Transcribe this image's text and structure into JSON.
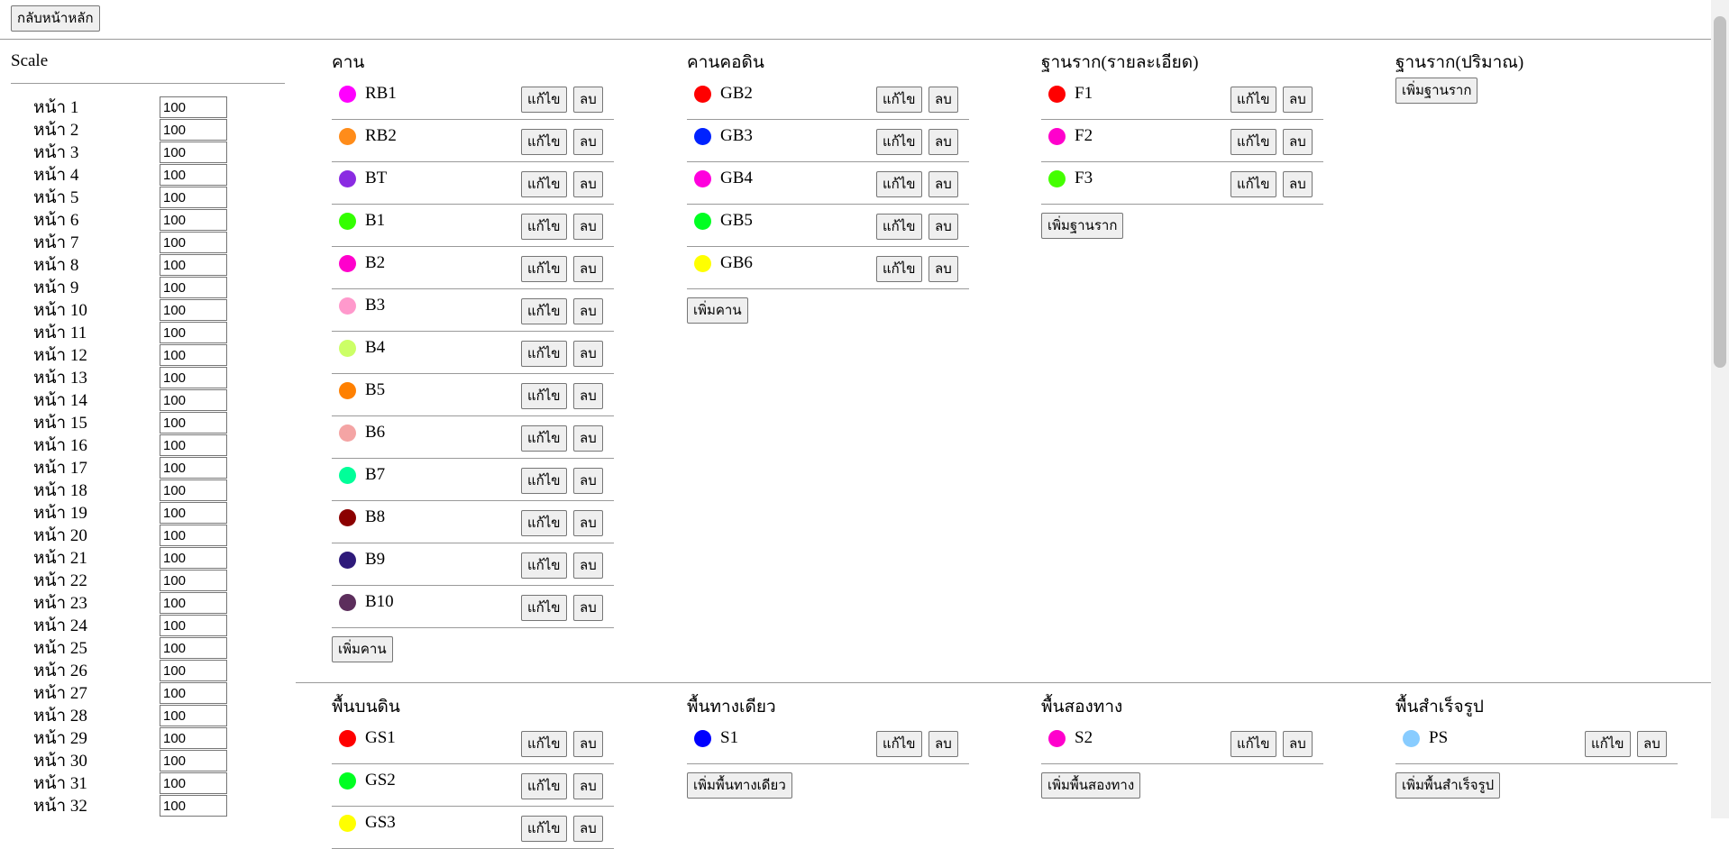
{
  "home_button": "กลับหน้าหลัก",
  "sidebar": {
    "title": "Scale",
    "pages": [
      {
        "label": "หน้า 1",
        "value": "100"
      },
      {
        "label": "หน้า 2",
        "value": "100"
      },
      {
        "label": "หน้า 3",
        "value": "100"
      },
      {
        "label": "หน้า 4",
        "value": "100"
      },
      {
        "label": "หน้า 5",
        "value": "100"
      },
      {
        "label": "หน้า 6",
        "value": "100"
      },
      {
        "label": "หน้า 7",
        "value": "100"
      },
      {
        "label": "หน้า 8",
        "value": "100"
      },
      {
        "label": "หน้า 9",
        "value": "100"
      },
      {
        "label": "หน้า 10",
        "value": "100"
      },
      {
        "label": "หน้า 11",
        "value": "100"
      },
      {
        "label": "หน้า 12",
        "value": "100"
      },
      {
        "label": "หน้า 13",
        "value": "100"
      },
      {
        "label": "หน้า 14",
        "value": "100"
      },
      {
        "label": "หน้า 15",
        "value": "100"
      },
      {
        "label": "หน้า 16",
        "value": "100"
      },
      {
        "label": "หน้า 17",
        "value": "100"
      },
      {
        "label": "หน้า 18",
        "value": "100"
      },
      {
        "label": "หน้า 19",
        "value": "100"
      },
      {
        "label": "หน้า 20",
        "value": "100"
      },
      {
        "label": "หน้า 21",
        "value": "100"
      },
      {
        "label": "หน้า 22",
        "value": "100"
      },
      {
        "label": "หน้า 23",
        "value": "100"
      },
      {
        "label": "หน้า 24",
        "value": "100"
      },
      {
        "label": "หน้า 25",
        "value": "100"
      },
      {
        "label": "หน้า 26",
        "value": "100"
      },
      {
        "label": "หน้า 27",
        "value": "100"
      },
      {
        "label": "หน้า 28",
        "value": "100"
      },
      {
        "label": "หน้า 29",
        "value": "100"
      },
      {
        "label": "หน้า 30",
        "value": "100"
      },
      {
        "label": "หน้า 31",
        "value": "100"
      },
      {
        "label": "หน้า 32",
        "value": "100"
      }
    ]
  },
  "labels": {
    "edit": "แก้ไข",
    "delete": "ลบ"
  },
  "groups": [
    {
      "title": "คาน",
      "add_label": "เพิ่มคาน",
      "items": [
        {
          "name": "RB1",
          "color": "#ff00ff"
        },
        {
          "name": "RB2",
          "color": "#ff8c1a"
        },
        {
          "name": "BT",
          "color": "#8a2be2"
        },
        {
          "name": "B1",
          "color": "#33ff00"
        },
        {
          "name": "B2",
          "color": "#ff00cc"
        },
        {
          "name": "B3",
          "color": "#ff99cc"
        },
        {
          "name": "B4",
          "color": "#ccff66"
        },
        {
          "name": "B5",
          "color": "#ff8000"
        },
        {
          "name": "B6",
          "color": "#f4a4a4"
        },
        {
          "name": "B7",
          "color": "#00ff99"
        },
        {
          "name": "B8",
          "color": "#8b0000"
        },
        {
          "name": "B9",
          "color": "#2e1a7a"
        },
        {
          "name": "B10",
          "color": "#5c2e5c"
        }
      ]
    },
    {
      "title": "คานคอดิน",
      "add_label": "เพิ่มคาน",
      "items": [
        {
          "name": "GB2",
          "color": "#ff0000"
        },
        {
          "name": "GB3",
          "color": "#0022ff"
        },
        {
          "name": "GB4",
          "color": "#ff00dd"
        },
        {
          "name": "GB5",
          "color": "#00ff22"
        },
        {
          "name": "GB6",
          "color": "#ffff00"
        }
      ]
    },
    {
      "title": "ฐานราก(รายละเอียด)",
      "add_label": "เพิ่มฐานราก",
      "items": [
        {
          "name": "F1",
          "color": "#ff0000"
        },
        {
          "name": "F2",
          "color": "#ff00cc"
        },
        {
          "name": "F3",
          "color": "#44ff00"
        }
      ]
    },
    {
      "title": "ฐานราก(ปริมาณ)",
      "add_label": "เพิ่มฐานราก",
      "items": []
    },
    {
      "title": "พื้นบนดิน",
      "add_label": "",
      "items": [
        {
          "name": "GS1",
          "color": "#ff0000"
        },
        {
          "name": "GS2",
          "color": "#00ff22"
        },
        {
          "name": "GS3",
          "color": "#ffff00"
        }
      ]
    },
    {
      "title": "พื้นทางเดียว",
      "add_label": "เพิ่มพื้นทางเดียว",
      "items": [
        {
          "name": "S1",
          "color": "#0000ff"
        }
      ]
    },
    {
      "title": "พื้นสองทาง",
      "add_label": "เพิ่มพื้นสองทาง",
      "items": [
        {
          "name": "S2",
          "color": "#ff00cc"
        }
      ]
    },
    {
      "title": "พื้นสำเร็จรูป",
      "add_label": "เพิ่มพื้นสำเร็จรูป",
      "items": [
        {
          "name": "PS",
          "color": "#88ccff"
        }
      ]
    }
  ]
}
